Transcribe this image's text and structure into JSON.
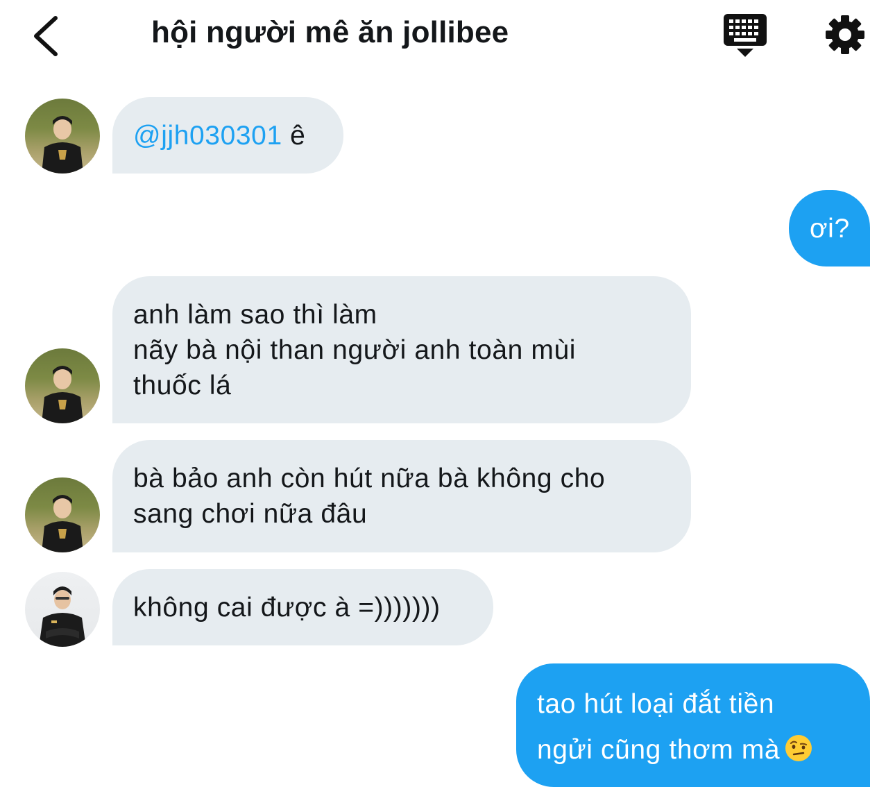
{
  "header": {
    "title": "hội người mê ăn jollibee",
    "back_icon": "chevron-left-icon",
    "keyboard_icon": "keyboard-icon",
    "settings_icon": "gear-icon"
  },
  "colors": {
    "outgoing_bubble": "#1da1f2",
    "incoming_bubble": "#e6ecf0",
    "mention": "#1da1f2",
    "text": "#14171a"
  },
  "messages": [
    {
      "direction": "incoming",
      "mention": "@jjh030301",
      "text": " ê"
    },
    {
      "direction": "outgoing",
      "text": "ơi?"
    },
    {
      "direction": "incoming",
      "lines": [
        "anh làm sao thì làm",
        "nãy bà nội than người anh toàn mùi",
        "thuốc lá"
      ]
    },
    {
      "direction": "incoming",
      "lines": [
        "bà bảo anh còn hút nữa bà không cho",
        "sang chơi nữa đâu"
      ]
    },
    {
      "direction": "incoming",
      "text": "không cai được à =)))))))"
    },
    {
      "direction": "outgoing",
      "lines": [
        "tao hút loại đắt tiền",
        "ngửi cũng thơm mà"
      ],
      "emoji": "raised-eyebrow-emoji"
    }
  ]
}
